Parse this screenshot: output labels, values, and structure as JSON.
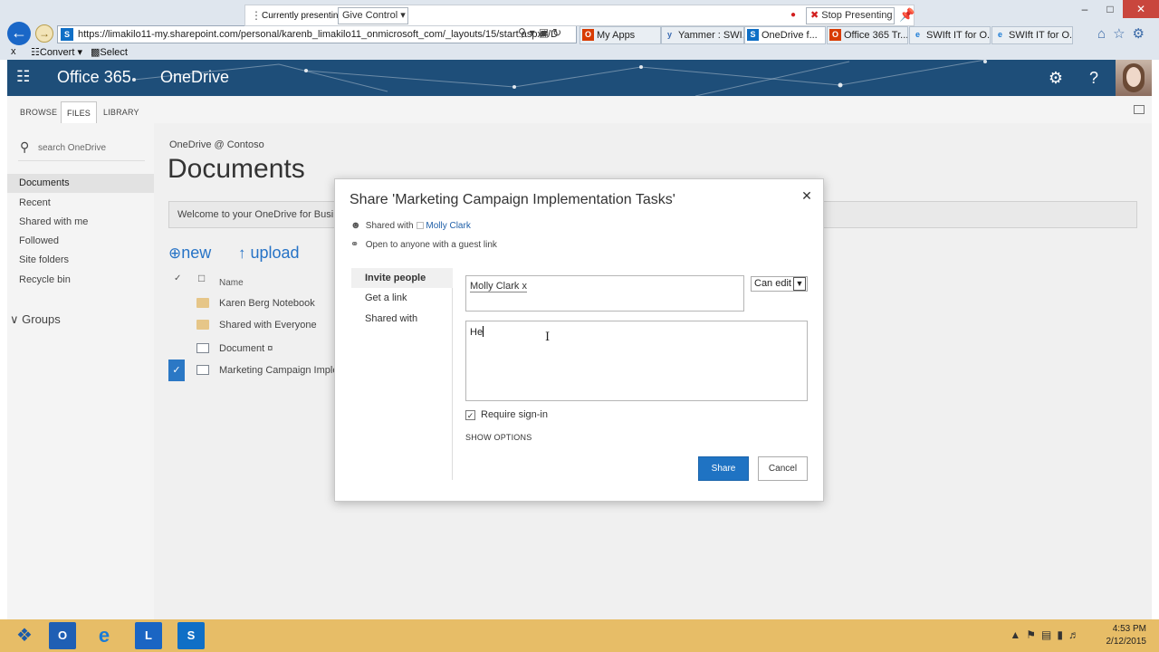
{
  "browser": {
    "url": "https://limakilo11-my.sharepoint.com/personal/karenb_limakilo11_onmicrosoft_com/_layouts/15/start.aspx#/D",
    "tabs": [
      {
        "label": "My Apps",
        "icon": "office-icon",
        "active": false
      },
      {
        "label": "Yammer : SWI...",
        "icon": "yammer-icon",
        "active": false
      },
      {
        "label": "OneDrive f...",
        "icon": "sharepoint-icon",
        "active": true
      },
      {
        "label": "Office 365 Tr...",
        "icon": "office-icon",
        "active": false
      },
      {
        "label": "SWIft IT for O...",
        "icon": "ie-icon",
        "active": false
      },
      {
        "label": "SWIft IT for O...",
        "icon": "ie-icon",
        "active": false
      }
    ],
    "commands": {
      "close": "x",
      "convert": "Convert",
      "select": "Select"
    }
  },
  "presenting": {
    "label": "Currently presenting",
    "give_control": "Give Control",
    "stop": "Stop Presenting"
  },
  "suite": {
    "brand": "Office 365",
    "app": "OneDrive",
    "color": "#1e4e79"
  },
  "ribbon": {
    "tabs": [
      "BROWSE",
      "FILES",
      "LIBRARY"
    ],
    "active": "FILES"
  },
  "leftnav": {
    "search_placeholder": "search OneDrive",
    "items": [
      "Documents",
      "Recent",
      "Shared with me",
      "Followed",
      "Site folders",
      "Recycle bin"
    ],
    "active": "Documents",
    "groups_label": "Groups"
  },
  "main": {
    "breadcrumb": "OneDrive @ Contoso",
    "title": "Documents",
    "welcome": "Welcome to your OneDrive for Busin",
    "new_label": "new",
    "upload_label": "upload",
    "name_header": "Name",
    "files": [
      {
        "name": "Karen Berg Notebook",
        "type": "folder",
        "selected": false
      },
      {
        "name": "Shared with Everyone",
        "type": "folder",
        "selected": false
      },
      {
        "name": "Document ¤",
        "type": "doc",
        "selected": false
      },
      {
        "name": "Marketing Campaign Imple",
        "type": "doc",
        "selected": true
      }
    ]
  },
  "dialog": {
    "title": "Share 'Marketing Campaign Implementation Tasks'",
    "shared_with_label": "Shared with",
    "shared_with_person": "Molly Clark",
    "guest_link_text": "Open to anyone with a guest link",
    "tabs": [
      "Invite people",
      "Get a link",
      "Shared with"
    ],
    "active_tab": "Invite people",
    "invitee": "Molly Clark",
    "invitee_remove": "x",
    "permission": "Can edit",
    "message": "He",
    "require_signin": "Require sign-in",
    "require_signin_checked": true,
    "show_options": "SHOW OPTIONS",
    "share_button": "Share",
    "cancel_button": "Cancel",
    "accent": "#1f73c3"
  },
  "taskbar": {
    "time": "4:53 PM",
    "date": "2/12/2015",
    "apps": [
      "outlook-icon",
      "ie-icon",
      "lync-icon",
      "sharepoint-icon"
    ]
  }
}
